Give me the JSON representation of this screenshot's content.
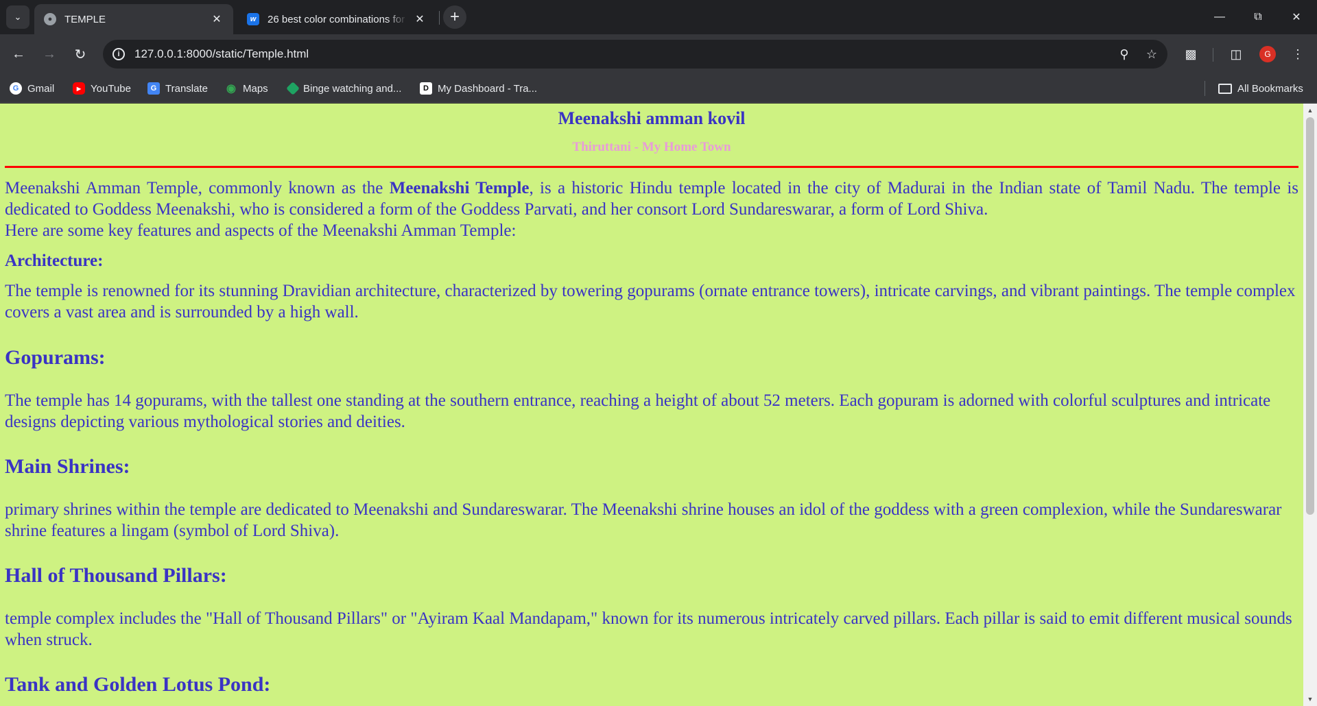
{
  "browser": {
    "tabs": [
      {
        "title": "TEMPLE",
        "active": true,
        "favicon": "globe-icon"
      },
      {
        "title": "26 best color combinations for",
        "active": false,
        "favicon": "w-logo"
      }
    ],
    "url": "127.0.0.1:8000/static/Temple.html",
    "profile_initial": "G",
    "bookmarks": [
      {
        "label": "Gmail",
        "icon": "google-icon"
      },
      {
        "label": "YouTube",
        "icon": "youtube-icon"
      },
      {
        "label": "Translate",
        "icon": "translate-icon"
      },
      {
        "label": "Maps",
        "icon": "maps-icon"
      },
      {
        "label": "Binge watching and...",
        "icon": "binge-icon"
      },
      {
        "label": "My Dashboard - Tra...",
        "icon": "dashboard-icon"
      }
    ],
    "all_bookmarks": "All Bookmarks"
  },
  "page": {
    "title": "Meenakshi amman kovil",
    "subtitle": "Thiruttani - My Home Town",
    "colors": {
      "background": "#cef282",
      "text": "#3a33c4",
      "subtitle": "#e89bd9",
      "rule": "#ff0000"
    },
    "intro": {
      "before": "Meenakshi Amman Temple, commonly known as the ",
      "bold": "Meenakshi Temple",
      "after": ", is a historic Hindu temple located in the city of Madurai in the Indian state of Tamil Nadu. The temple is dedicated to Goddess Meenakshi, who is considered a form of the Goddess Parvati, and her consort Lord Sundareswarar, a form of Lord Shiva.",
      "line2": "Here are some key features and aspects of the Meenakshi Amman Temple:"
    },
    "sections": [
      {
        "heading": "Architecture:",
        "text": "The temple is renowned for its stunning Dravidian architecture, characterized by towering gopurams (ornate entrance towers), intricate carvings, and vibrant paintings. The temple complex covers a vast area and is surrounded by a high wall."
      },
      {
        "heading": "Gopurams:",
        "text": "The temple has 14 gopurams, with the tallest one standing at the southern entrance, reaching a height of about 52 meters. Each gopuram is adorned with colorful sculptures and intricate designs depicting various mythological stories and deities."
      },
      {
        "heading": "Main Shrines:",
        "text": "primary shrines within the temple are dedicated to Meenakshi and Sundareswarar. The Meenakshi shrine houses an idol of the goddess with a green complexion, while the Sundareswarar shrine features a lingam (symbol of Lord Shiva)."
      },
      {
        "heading": "Hall of Thousand Pillars:",
        "text": "temple complex includes the \"Hall of Thousand Pillars\" or \"Ayiram Kaal Mandapam,\" known for its numerous intricately carved pillars. Each pillar is said to emit different musical sounds when struck."
      },
      {
        "heading": "Tank and Golden Lotus Pond:",
        "text": ""
      }
    ]
  }
}
